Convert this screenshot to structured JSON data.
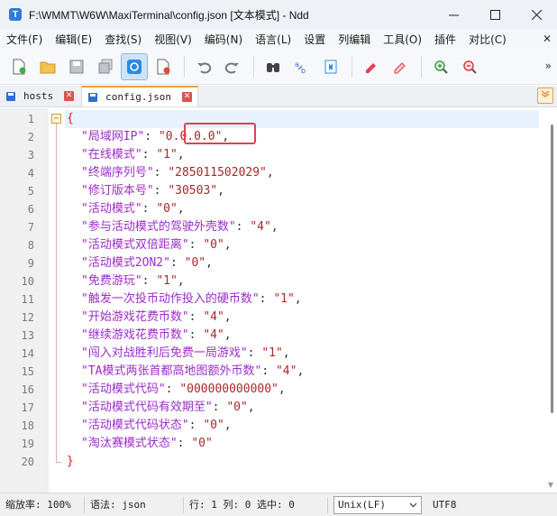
{
  "window": {
    "title": "F:\\WMMT\\W6W\\MaxiTerminal\\config.json [文本模式] - Ndd",
    "app_icon_letter": "T"
  },
  "menu": [
    {
      "label": "文件(F)"
    },
    {
      "label": "编辑(E)"
    },
    {
      "label": "查找(S)"
    },
    {
      "label": "视图(V)"
    },
    {
      "label": "编码(N)"
    },
    {
      "label": "语言(L)"
    },
    {
      "label": "设置"
    },
    {
      "label": "列编辑"
    },
    {
      "label": "工具(O)"
    },
    {
      "label": "插件"
    },
    {
      "label": "对比(C)"
    }
  ],
  "menu_close": "✕",
  "toolbar_overflow": "»",
  "tabs": [
    {
      "label": "hosts",
      "active": false
    },
    {
      "label": "config.json",
      "active": true
    }
  ],
  "editor": {
    "lines": [
      {
        "num": "1",
        "text": "{"
      },
      {
        "num": "2",
        "key": "\"局域网IP\"",
        "value": "\"0.0.0.0\"",
        "tail": ","
      },
      {
        "num": "3",
        "key": "\"在线模式\"",
        "value": "\"1\"",
        "tail": ","
      },
      {
        "num": "4",
        "key": "\"终端序列号\"",
        "value": "\"285011502029\"",
        "tail": ","
      },
      {
        "num": "5",
        "key": "\"修订版本号\"",
        "value": "\"30503\"",
        "tail": ","
      },
      {
        "num": "6",
        "key": "\"活动模式\"",
        "value": "\"0\"",
        "tail": ","
      },
      {
        "num": "7",
        "key": "\"参与活动模式的驾驶外壳数\"",
        "value": "\"4\"",
        "tail": ","
      },
      {
        "num": "8",
        "key": "\"活动模式双倍距离\"",
        "value": "\"0\"",
        "tail": ","
      },
      {
        "num": "9",
        "key": "\"活动模式2ON2\"",
        "value": "\"0\"",
        "tail": ","
      },
      {
        "num": "10",
        "key": "\"免费游玩\"",
        "value": "\"1\"",
        "tail": ","
      },
      {
        "num": "11",
        "key": "\"触发一次投币动作投入的硬币数\"",
        "value": "\"1\"",
        "tail": ","
      },
      {
        "num": "12",
        "key": "\"开始游戏花费币数\"",
        "value": "\"4\"",
        "tail": ","
      },
      {
        "num": "13",
        "key": "\"继续游戏花费币数\"",
        "value": "\"4\"",
        "tail": ","
      },
      {
        "num": "14",
        "key": "\"闯入对战胜利后免费一局游戏\"",
        "value": "\"1\"",
        "tail": ","
      },
      {
        "num": "15",
        "key": "\"TA模式两张首都高地图额外币数\"",
        "value": "\"4\"",
        "tail": ","
      },
      {
        "num": "16",
        "key": "\"活动模式代码\"",
        "value": "\"000000000000\"",
        "tail": ","
      },
      {
        "num": "17",
        "key": "\"活动模式代码有效期至\"",
        "value": "\"0\"",
        "tail": ","
      },
      {
        "num": "18",
        "key": "\"活动模式代码状态\"",
        "value": "\"0\"",
        "tail": ","
      },
      {
        "num": "19",
        "key": "\"淘汰赛模式状态\"",
        "value": "\"0\"",
        "tail": ""
      },
      {
        "num": "20",
        "text": "}"
      }
    ]
  },
  "status": {
    "zoom": "缩放率: 100%",
    "syntax": "语法: json",
    "position": "行: 1 列: 0 选中: 0",
    "eol": "Unix(LF)",
    "encoding": "UTF8"
  },
  "colors": {
    "key": "#9b2cc9",
    "value": "#a32a2a",
    "highlight": "#e04050",
    "active_tab_accent": "#f0a030"
  }
}
